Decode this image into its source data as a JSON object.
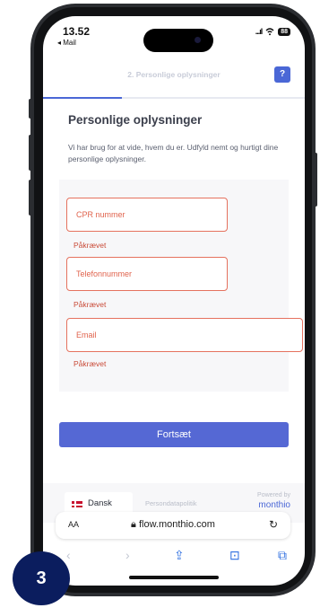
{
  "status": {
    "time": "13.52",
    "back_app": "◂ Mail",
    "signal": "...ıl",
    "battery": "88"
  },
  "header": {
    "step_title": "2. Personlige oplysninger",
    "help_label": "?",
    "progress_percent": 30
  },
  "page": {
    "heading": "Personlige oplysninger",
    "intro": "Vi har brug for at vide, hvem du er. Udfyld nemt og hurtigt dine personlige oplysninger."
  },
  "form": {
    "fields": [
      {
        "placeholder": "CPR nummer",
        "error": "Påkrævet"
      },
      {
        "placeholder": "Telefonnummer",
        "error": "Påkrævet"
      },
      {
        "placeholder": "Email",
        "error": "Påkrævet"
      }
    ],
    "submit_label": "Fortsæt"
  },
  "footer": {
    "language": "Dansk",
    "privacy": "Persondatapolitik",
    "powered_by": "Powered by",
    "brand": "monthio"
  },
  "browser": {
    "aa": "AA",
    "url": "flow.monthio.com",
    "reload": "↻"
  },
  "toolbar": {
    "back": "‹",
    "forward": "›",
    "share": "⇪",
    "bookmarks": "⊡",
    "tabs": "⧉"
  },
  "badge": {
    "label": "3"
  },
  "colors": {
    "accent": "#4a67d6",
    "button": "#5568d4",
    "error": "#e5725f",
    "badge": "#0b1d5e"
  }
}
